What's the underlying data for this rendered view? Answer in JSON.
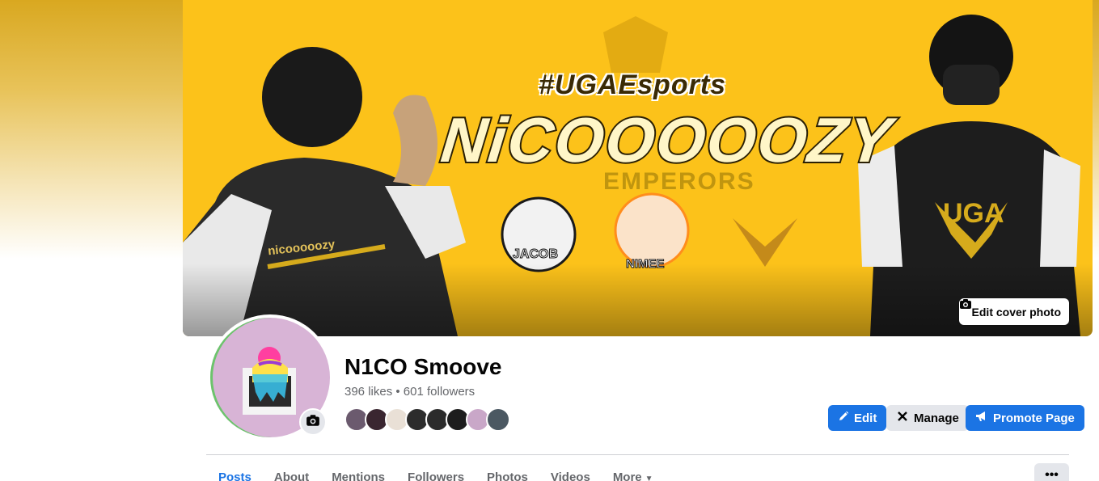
{
  "cover": {
    "hashtag": "#UGAEsports",
    "title": "NiCOOOOOZY",
    "subtitle": "EMPERORS",
    "badge_left": "JACOB",
    "badge_mid": "NIMEE",
    "jersey_text": "nicooooozy",
    "jersey_logo": "UGA",
    "edit_button_label": "Edit cover photo",
    "edit_icon": "camera-icon"
  },
  "profile": {
    "name": "N1CO Smoove",
    "stats": "396 likes • 601 followers",
    "avatar_camera_icon": "camera-icon",
    "friend_count": 8
  },
  "actions": {
    "edit_label": "Edit",
    "edit_icon": "pencil-icon",
    "manage_label": "Manage",
    "manage_icon": "manage-icon",
    "promote_label": "Promote Page",
    "promote_icon": "megaphone-icon"
  },
  "tabs": [
    {
      "label": "Posts",
      "active": true
    },
    {
      "label": "About"
    },
    {
      "label": "Mentions"
    },
    {
      "label": "Followers"
    },
    {
      "label": "Photos"
    },
    {
      "label": "Videos"
    },
    {
      "label": "More"
    }
  ],
  "more_button": "•••",
  "colors": {
    "accent": "#1b74e4",
    "cover_yellow": "#fcc21a",
    "secondary_btn": "#e4e6eb",
    "muted_text": "#65676b"
  }
}
